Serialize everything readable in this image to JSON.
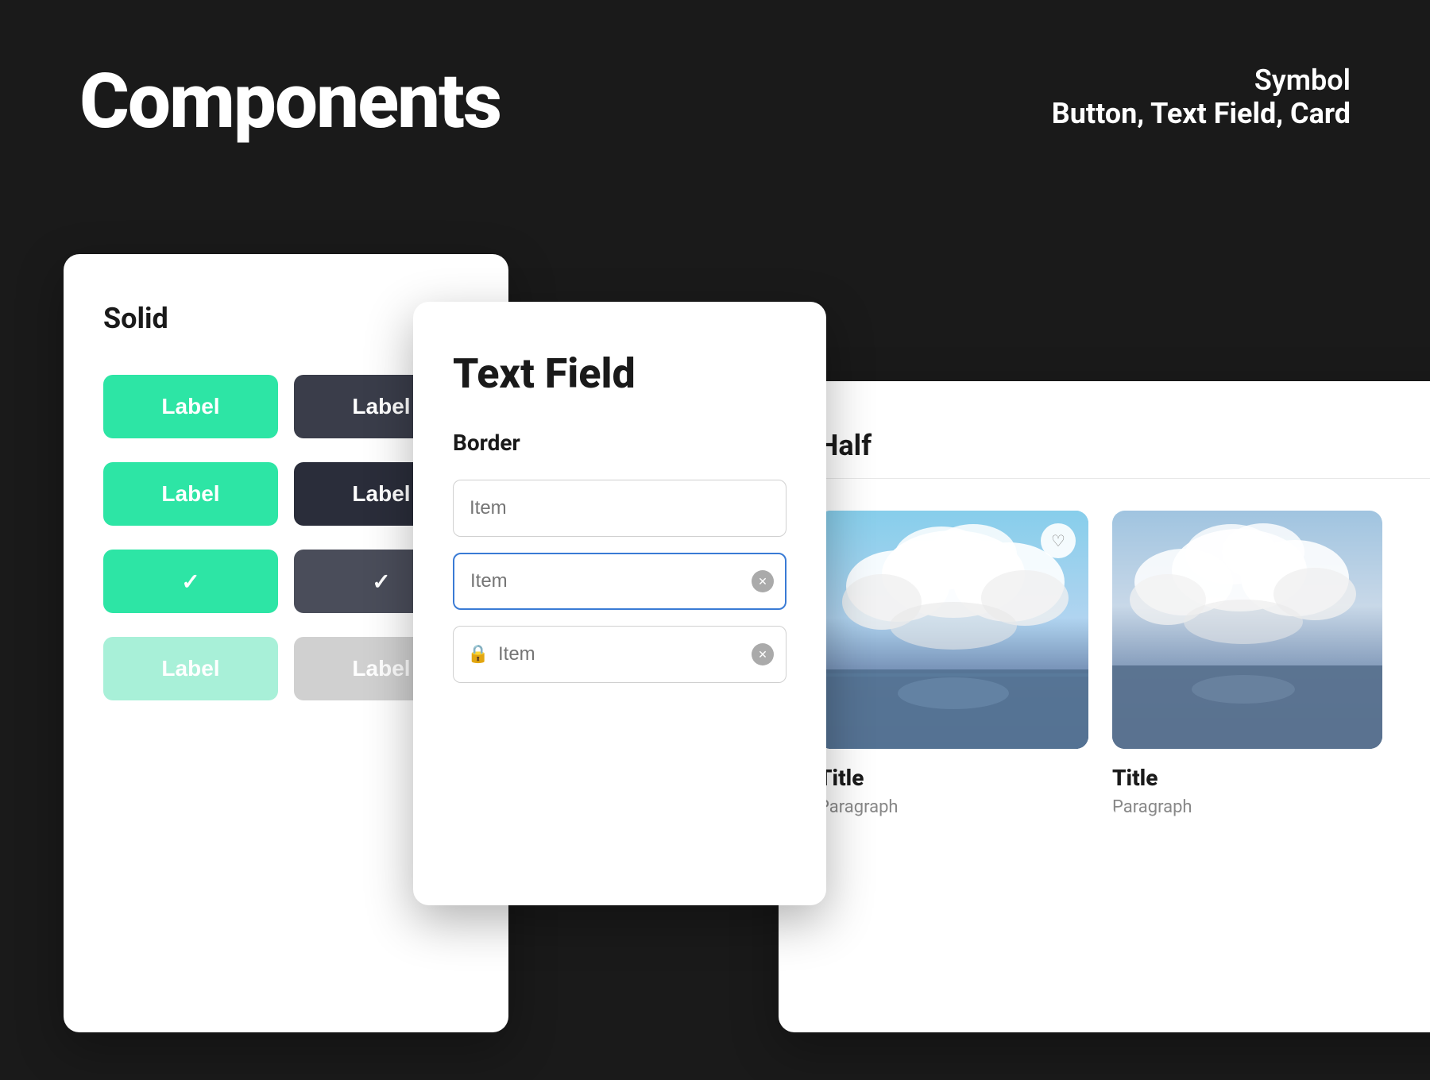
{
  "page": {
    "background": "#1a1a1a",
    "title": "Components",
    "subtitle": {
      "symbol": "Symbol",
      "types": "Button, Text Field, Card"
    }
  },
  "solid_panel": {
    "title": "Solid",
    "buttons": [
      {
        "label": "Label",
        "style": "green"
      },
      {
        "label": "Label",
        "style": "dark"
      },
      {
        "label": "Label",
        "style": "green"
      },
      {
        "label": "Label",
        "style": "dark-solid"
      },
      {
        "label": "✓",
        "style": "green-check"
      },
      {
        "label": "✓",
        "style": "dark-check"
      },
      {
        "label": "Label",
        "style": "green-light"
      },
      {
        "label": "Label",
        "style": "gray-light"
      }
    ]
  },
  "textfield_panel": {
    "title": "Text Field",
    "section": "Border",
    "fields": [
      {
        "placeholder": "Item",
        "state": "default"
      },
      {
        "placeholder": "Item",
        "state": "active"
      },
      {
        "placeholder": "Item",
        "state": "locked",
        "icon": "lock"
      }
    ]
  },
  "card_panel": {
    "title": "Half",
    "cards": [
      {
        "image_alt": "Ocean clouds",
        "title": "Title",
        "paragraph": "Paragraph",
        "has_heart": true
      },
      {
        "image_alt": "Ocean clouds 2",
        "title": "Title",
        "paragraph": "Paragraph",
        "has_heart": false
      }
    ]
  }
}
